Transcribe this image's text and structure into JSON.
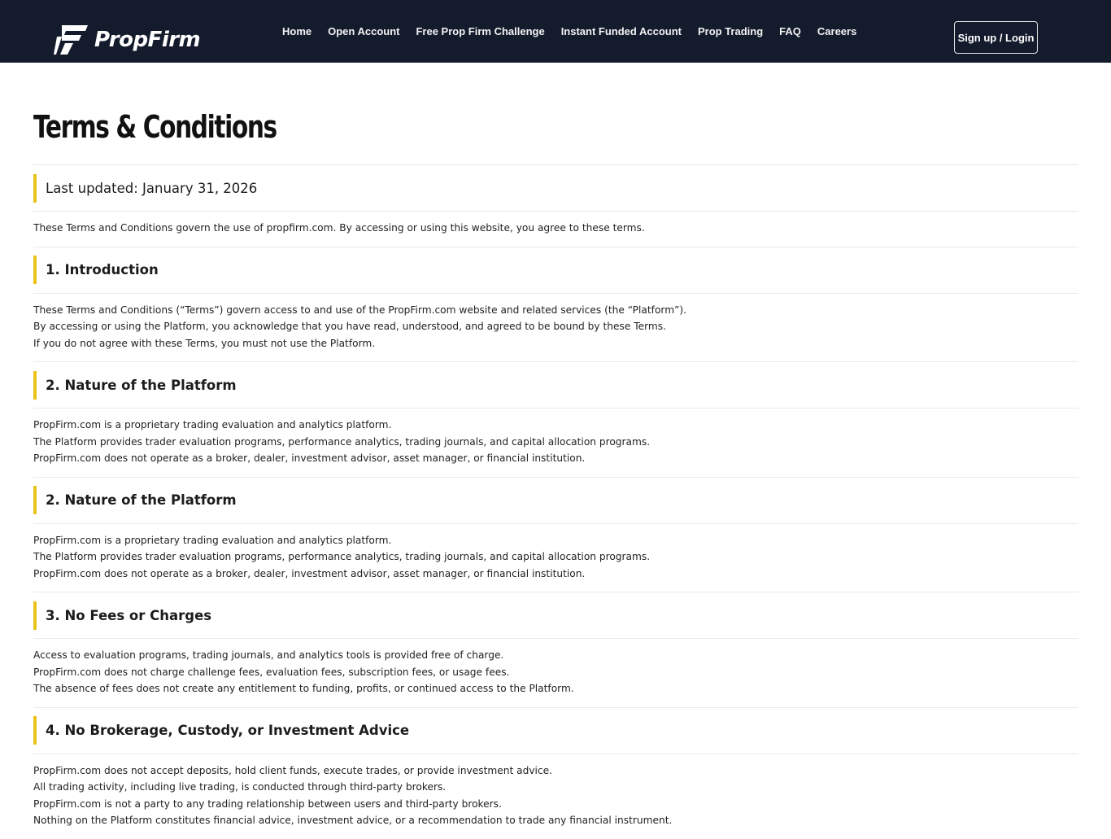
{
  "brand": {
    "name": "PropFirm",
    "logo_icon": "propfirm-logo-icon"
  },
  "nav": {
    "items": [
      {
        "label": "Home"
      },
      {
        "label": "Open Account"
      },
      {
        "label": "Free Prop Firm Challenge"
      },
      {
        "label": "Instant Funded Account"
      },
      {
        "label": "Prop Trading"
      },
      {
        "label": "FAQ"
      },
      {
        "label": "Careers"
      }
    ],
    "signup_label": "Sign up / Login"
  },
  "page": {
    "title": "Terms & Conditions",
    "last_updated": "Last updated: January 31, 2026",
    "intro": "These Terms and Conditions govern the use of propfirm.com. By accessing or using this website, you agree to these terms."
  },
  "sections": [
    {
      "title": "1. Introduction",
      "lines": [
        "These Terms and Conditions (“Terms”) govern access to and use of the PropFirm.com website and related services (the “Platform”).",
        "By accessing or using the Platform, you acknowledge that you have read, understood, and agreed to be bound by these Terms.",
        "If you do not agree with these Terms, you must not use the Platform."
      ]
    },
    {
      "title": "2. Nature of the Platform",
      "lines": [
        "PropFirm.com is a proprietary trading evaluation and analytics platform.",
        "The Platform provides trader evaluation programs, performance analytics, trading journals, and capital allocation programs.",
        "PropFirm.com does not operate as a broker, dealer, investment advisor, asset manager, or financial institution."
      ]
    },
    {
      "title": "2. Nature of the Platform",
      "lines": [
        "PropFirm.com is a proprietary trading evaluation and analytics platform.",
        "The Platform provides trader evaluation programs, performance analytics, trading journals, and capital allocation programs.",
        "PropFirm.com does not operate as a broker, dealer, investment advisor, asset manager, or financial institution."
      ]
    },
    {
      "title": "3. No Fees or Charges",
      "lines": [
        "Access to evaluation programs, trading journals, and analytics tools is provided free of charge.",
        "PropFirm.com does not charge challenge fees, evaluation fees, subscription fees, or usage fees.",
        "The absence of fees does not create any entitlement to funding, profits, or continued access to the Platform."
      ]
    },
    {
      "title": "4. No Brokerage, Custody, or Investment Advice",
      "lines": [
        "PropFirm.com does not accept deposits, hold client funds, execute trades, or provide investment advice.",
        "All trading activity, including live trading, is conducted through third-party brokers.",
        "PropFirm.com is not a party to any trading relationship between users and third-party brokers.",
        "Nothing on the Platform constitutes financial advice, investment advice, or a recommendation to trade any financial instrument."
      ]
    }
  ],
  "colors": {
    "header_bg": "#141b2d",
    "accent": "#e9c31a",
    "rule": "#eaeaea"
  }
}
